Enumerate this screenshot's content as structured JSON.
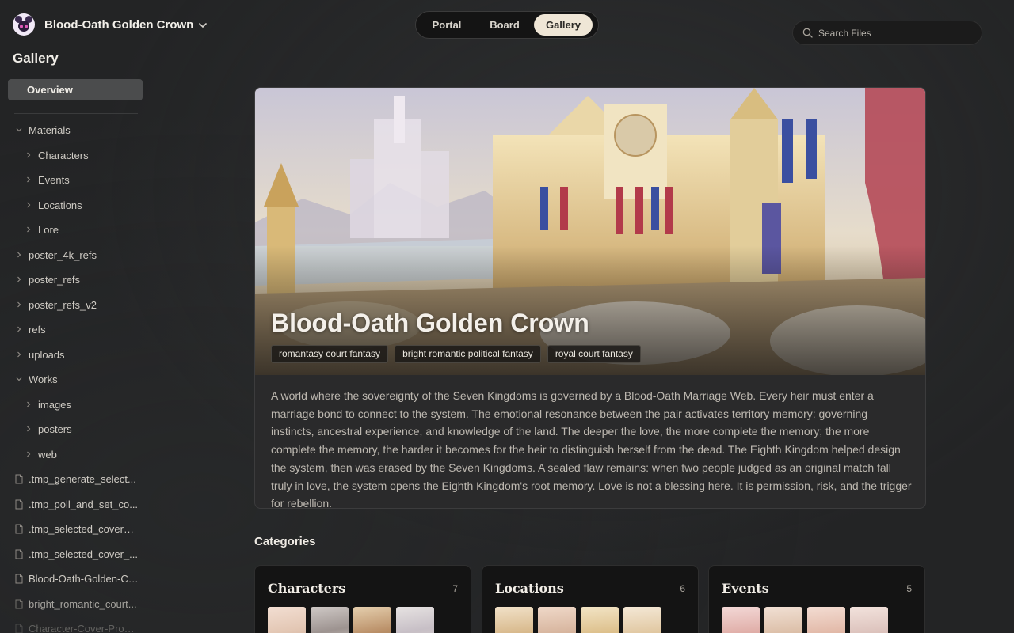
{
  "workspace": {
    "name": "Blood-Oath Golden Crown"
  },
  "sidebar": {
    "section_title": "Gallery",
    "overview_label": "Overview",
    "tree": [
      {
        "label": "Materials",
        "kind": "folder",
        "expanded": true
      },
      {
        "label": "Characters",
        "kind": "folder",
        "expanded": false
      },
      {
        "label": "Events",
        "kind": "folder",
        "expanded": false
      },
      {
        "label": "Locations",
        "kind": "folder",
        "expanded": false
      },
      {
        "label": "Lore",
        "kind": "folder",
        "expanded": false
      },
      {
        "label": "poster_4k_refs",
        "kind": "folder",
        "expanded": false
      },
      {
        "label": "poster_refs",
        "kind": "folder",
        "expanded": false
      },
      {
        "label": "poster_refs_v2",
        "kind": "folder",
        "expanded": false
      },
      {
        "label": "refs",
        "kind": "folder",
        "expanded": false
      },
      {
        "label": "uploads",
        "kind": "folder",
        "expanded": false
      },
      {
        "label": "Works",
        "kind": "folder",
        "expanded": true
      },
      {
        "label": "images",
        "kind": "folder",
        "expanded": false
      },
      {
        "label": "posters",
        "kind": "folder",
        "expanded": false
      },
      {
        "label": "web",
        "kind": "folder",
        "expanded": false
      },
      {
        "label": ".tmp_generate_select...",
        "kind": "file"
      },
      {
        "label": ".tmp_poll_and_set_co...",
        "kind": "file"
      },
      {
        "label": ".tmp_selected_cover_j...",
        "kind": "file"
      },
      {
        "label": ".tmp_selected_cover_...",
        "kind": "file"
      },
      {
        "label": "Blood-Oath-Golden-Cr...",
        "kind": "file"
      },
      {
        "label": "bright_romantic_court...",
        "kind": "file"
      },
      {
        "label": "Character-Cover-Prom...",
        "kind": "file"
      }
    ]
  },
  "nav": {
    "tabs": [
      "Portal",
      "Board",
      "Gallery"
    ],
    "active": "Gallery"
  },
  "search": {
    "placeholder": "Search Files"
  },
  "hero": {
    "title": "Blood-Oath Golden Crown",
    "tags": [
      "romantasy court fantasy",
      "bright romantic political fantasy",
      "royal court fantasy"
    ],
    "description": "A world where the sovereignty of the Seven Kingdoms is governed by a Blood-Oath Marriage Web. Every heir must enter a marriage bond to connect to the system. The emotional resonance between the pair activates territory memory: governing instincts, ancestral experience, and knowledge of the land. The deeper the love, the more complete the memory; the more complete the memory, the harder it becomes for the heir to distinguish herself from the dead. The Eighth Kingdom helped design the system, then was erased by the Seven Kingdoms. A sealed flaw remains: when two people judged as an original match fall truly in love, the system opens the Eighth Kingdom's root memory. Love is not a blessing here. It is permission, risk, and the trigger for rebellion."
  },
  "categories": {
    "heading": "Categories",
    "items": [
      {
        "name": "Characters",
        "count": "7"
      },
      {
        "name": "Locations",
        "count": "6"
      },
      {
        "name": "Events",
        "count": "5"
      }
    ]
  },
  "colors": {
    "background": "#232425",
    "active_tab": "#efe6d6",
    "card": "#2a2a2b",
    "category_card": "#141414"
  }
}
